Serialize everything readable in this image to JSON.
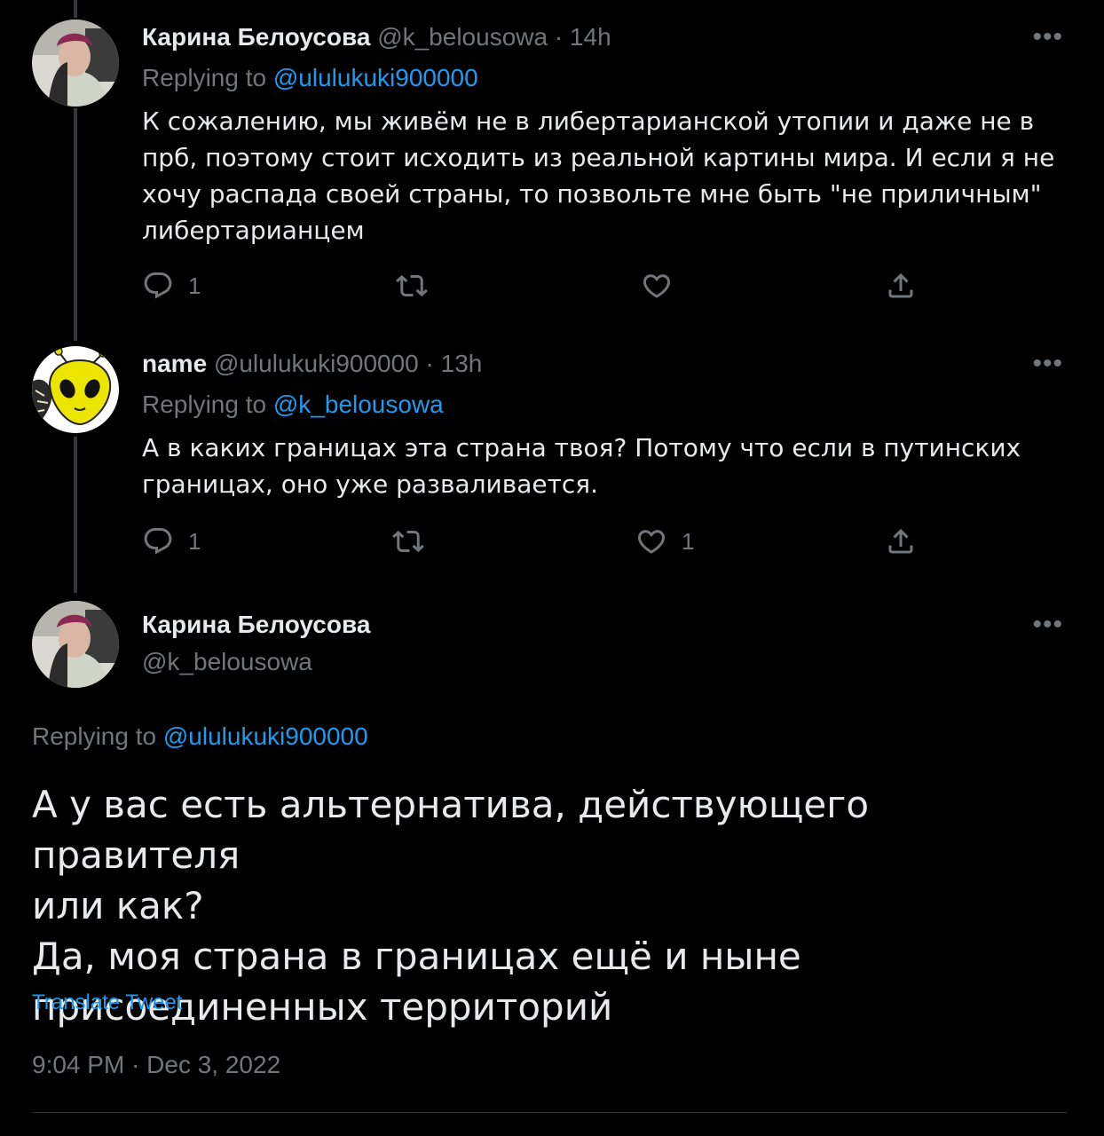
{
  "tweet1": {
    "name": "Карина Белоусова",
    "handle": "@k_belousowa",
    "time": "· 14h",
    "replying_prefix": "Replying to",
    "replying_to": "@ululukuki900000",
    "text": "К сожалению, мы живём не в либертарианской утопии и даже не в прб, поэтому стоит исходить из реальной картины мира. И если я не хочу распада своей страны, то позвольте мне быть \"не приличным\" либертарианцем",
    "reply_count": "1",
    "like_count": ""
  },
  "tweet2": {
    "name": "name",
    "handle": "@ululukuki900000",
    "time": "· 13h",
    "replying_prefix": "Replying to",
    "replying_to": "@k_belousowa",
    "text": "А в каких границах эта страна твоя? Потому что если в путинских границах, оно уже разваливается.",
    "reply_count": "1",
    "like_count": "1"
  },
  "main_tweet": {
    "name": "Карина Белоусова",
    "handle": "@k_belousowa",
    "replying_prefix": "Replying to",
    "replying_to": "@ululukuki900000",
    "text_line1": "А у вас есть альтернатива, действующего правителя",
    "text_line2": "или как?",
    "text_line3": "Да, моя страна в границах ещё и ныне",
    "text_line4": "присоединенных территорий",
    "translate": "Translate Tweet",
    "timestamp": "9:04 PM · Dec 3, 2022"
  },
  "icons": {
    "more": "more-horizontal-icon",
    "reply": "reply-icon",
    "retweet": "retweet-icon",
    "like": "heart-icon",
    "share": "share-icon"
  },
  "colors": {
    "background": "#000000",
    "text": "#e7e9ea",
    "muted": "#71767b",
    "link": "#1d9bf0"
  }
}
